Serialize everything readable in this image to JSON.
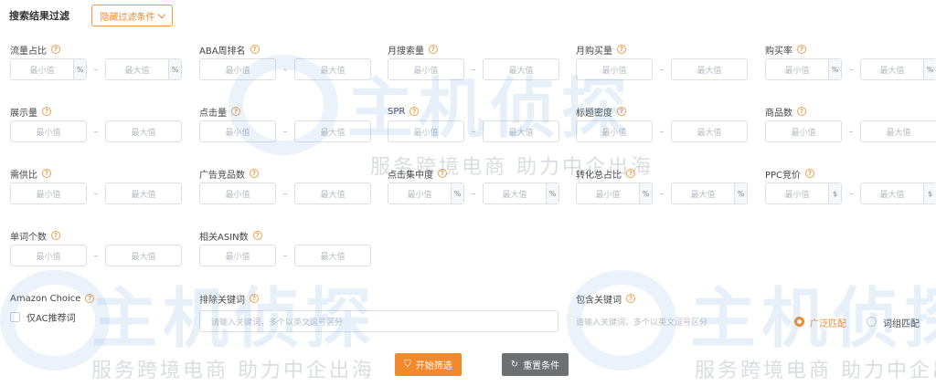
{
  "header": {
    "title": "搜索结果过滤",
    "hide_button": "隐藏过滤条件"
  },
  "placeholders": {
    "min": "最小值",
    "max": "最大值"
  },
  "fields": [
    {
      "label": "流量占比",
      "unit": "%"
    },
    {
      "label": "ABA周排名",
      "unit": ""
    },
    {
      "label": "月搜索量",
      "unit": ""
    },
    {
      "label": "月购买量",
      "unit": ""
    },
    {
      "label": "购买率",
      "unit": "%"
    },
    {
      "label": "展示量",
      "unit": ""
    },
    {
      "label": "点击量",
      "unit": ""
    },
    {
      "label": "SPR",
      "unit": ""
    },
    {
      "label": "标题密度",
      "unit": ""
    },
    {
      "label": "商品数",
      "unit": ""
    },
    {
      "label": "需供比",
      "unit": ""
    },
    {
      "label": "广告竞品数",
      "unit": ""
    },
    {
      "label": "点击集中度",
      "unit": "%"
    },
    {
      "label": "转化总占比",
      "unit": "%"
    },
    {
      "label": "PPC竞价",
      "unit": "$"
    },
    {
      "label": "单词个数",
      "unit": ""
    },
    {
      "label": "相关ASIN数",
      "unit": ""
    }
  ],
  "amazon_choice": {
    "label": "Amazon Choice",
    "checkbox_label": "仅AC推荐词"
  },
  "exclude": {
    "label": "排除关键词",
    "placeholder": "请输入关键词，多个以英文逗号区分"
  },
  "include": {
    "label": "包含关键词",
    "placeholder": "请输入关键词，多个以英文逗号区分"
  },
  "match": {
    "broad": "广泛匹配",
    "phrase": "词组匹配",
    "selected": "广泛匹配"
  },
  "buttons": {
    "start": "开始筛选",
    "reset": "重置条件"
  },
  "watermark": {
    "brand": "主机侦探",
    "slogan": "服务跨境电商 助力中企出海"
  },
  "colors": {
    "accent": "#f08a2c",
    "reset_button": "#6d6f73",
    "border": "#dcdfe6"
  }
}
